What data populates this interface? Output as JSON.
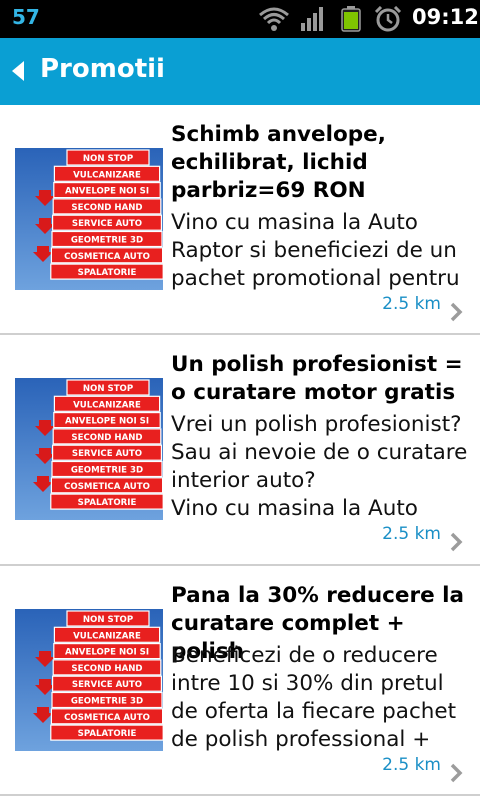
{
  "status_bar": {
    "notification": "57",
    "clock": "09:12",
    "icons": [
      "wifi-icon",
      "signal-icon",
      "battery-icon",
      "alarm-icon"
    ]
  },
  "action_bar": {
    "title": "Promotii",
    "back_icon": "back-arrow-icon"
  },
  "colors": {
    "action_bar": "#0a9fd3",
    "distance_text": "#1a8fc6",
    "notification": "#33b5e5"
  },
  "promotions": [
    {
      "title": "Schimb anvelope, echilibrat, lichid parbriz=69 RON",
      "description": "Vino cu masina la Auto Raptor si beneficiezi de un pachet promotional pentru",
      "distance": "2.5 km",
      "sign_lines": [
        "NON STOP",
        "VULCANIZARE",
        "ANVELOPE NOI SI",
        "SECOND HAND",
        "SERVICE AUTO",
        "GEOMETRIE 3D",
        "COSMETICA AUTO",
        "SPALATORIE"
      ]
    },
    {
      "title": "Un polish profesionist = o curatare motor gratis",
      "description": "Vrei un polish profesionist?\n Sau ai nevoie de o curatare interior auto?\nVino cu masina la Auto",
      "distance": "2.5 km",
      "sign_lines": [
        "NON STOP",
        "VULCANIZARE",
        "ANVELOPE NOI SI",
        "SECOND HAND",
        "SERVICE AUTO",
        "GEOMETRIE 3D",
        "COSMETICA AUTO",
        "SPALATORIE"
      ]
    },
    {
      "title": "Pana la 30% reducere la curatare complet + polish",
      "description": "Beneficezi de o reducere intre 10 si 30% din pretul de oferta la fiecare pachet de polish professional +",
      "distance": "2.5 km",
      "sign_lines": [
        "NON STOP",
        "VULCANIZARE",
        "ANVELOPE NOI SI",
        "SECOND HAND",
        "SERVICE AUTO",
        "GEOMETRIE 3D",
        "COSMETICA AUTO",
        "SPALATORIE"
      ]
    }
  ]
}
